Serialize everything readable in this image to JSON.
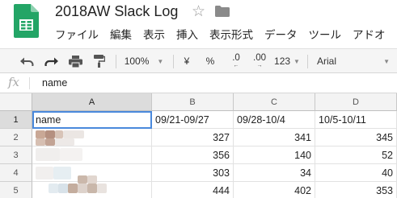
{
  "app": {
    "doc_title": "2018AW Slack Log",
    "menu": [
      "ファイル",
      "編集",
      "表示",
      "挿入",
      "表示形式",
      "データ",
      "ツール",
      "アドオ"
    ]
  },
  "toolbar": {
    "undo_icon": "undo-icon",
    "redo_icon": "redo-icon",
    "print_icon": "print-icon",
    "paint_format_icon": "paint-format-icon",
    "zoom": "100%",
    "currency": "¥",
    "percent": "%",
    "decrease_decimal": ".0",
    "increase_decimal": ".00",
    "number_format": "123",
    "font": "Arial"
  },
  "formula_bar": {
    "fx_label": "fx",
    "value": "name"
  },
  "grid": {
    "columns": [
      "A",
      "B",
      "C",
      "D"
    ],
    "rows": [
      "1",
      "2",
      "3",
      "4",
      "5"
    ],
    "header_row": [
      "name",
      "09/21-09/27",
      "09/28-10/4",
      "10/5-10/11"
    ],
    "data": [
      [
        "",
        "327",
        "341",
        "345"
      ],
      [
        "",
        "356",
        "140",
        "52"
      ],
      [
        "",
        "303",
        "34",
        "40"
      ],
      [
        "",
        "444",
        "402",
        "353"
      ]
    ]
  },
  "colors": {
    "sheets_green": "#23a566",
    "selection_blue": "#4a89dc"
  }
}
